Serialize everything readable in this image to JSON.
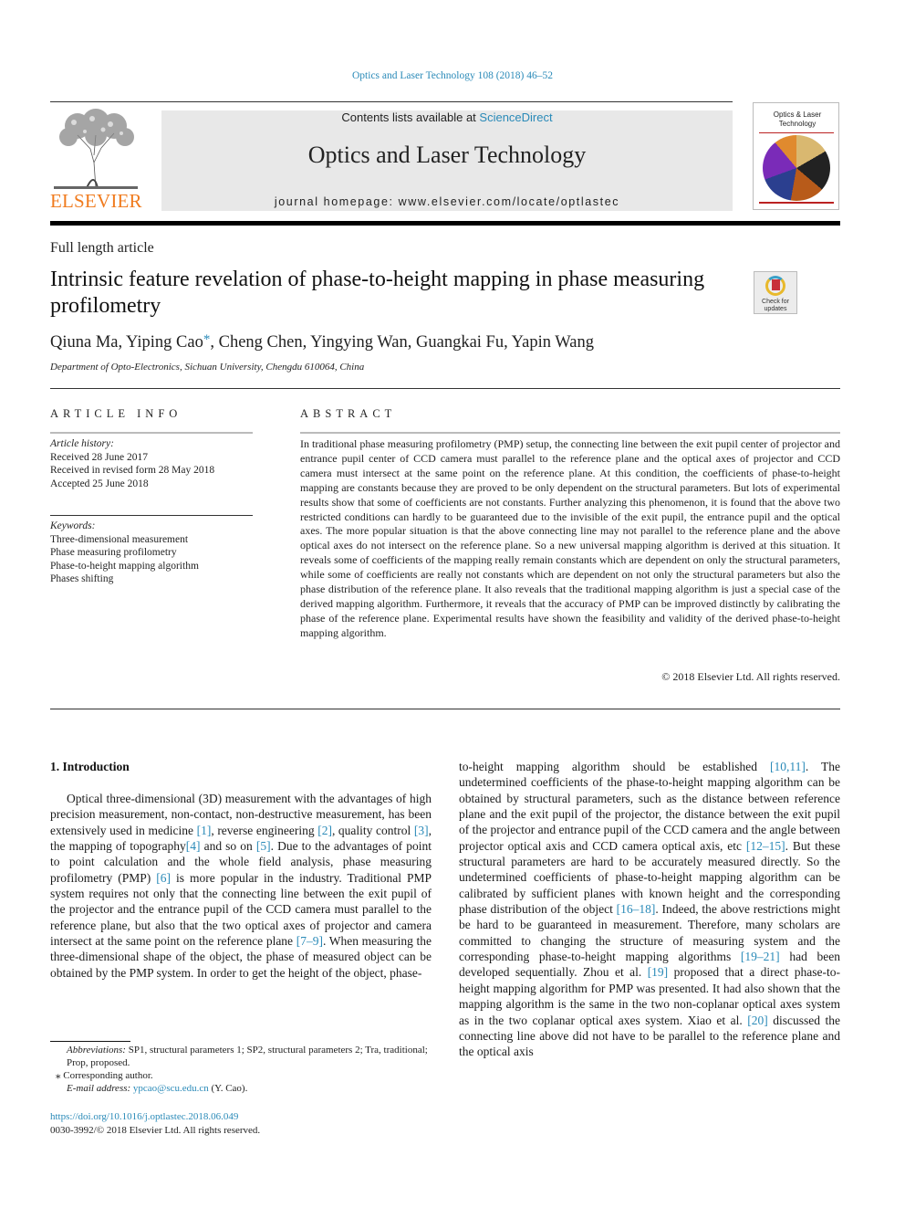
{
  "citation": "Optics and Laser Technology 108 (2018) 46–52",
  "header": {
    "publisher_logo_text": "ELSEVIER",
    "contents_prefix": "Contents lists available at ",
    "contents_link": "ScienceDirect",
    "journal_title": "Optics and Laser Technology",
    "homepage": "journal homepage: www.elsevier.com/locate/optlastec",
    "cover_title": "Optics & Laser Technology"
  },
  "article": {
    "type": "Full length article",
    "title": "Intrinsic feature revelation of phase-to-height mapping in phase measuring profilometry",
    "check_updates": "Check for updates",
    "authors_before": "Qiuna Ma, Yiping Cao",
    "author_star": "*",
    "authors_after": ", Cheng Chen, Yingying Wan, Guangkai Fu, Yapin Wang",
    "affiliation": "Department of Opto-Electronics, Sichuan University, Chengdu 610064, China"
  },
  "article_info": {
    "heading": "ARTICLE INFO",
    "history_label": "Article history:",
    "history": [
      "Received 28 June 2017",
      "Received in revised form 28 May 2018",
      "Accepted 25 June 2018"
    ],
    "keywords_label": "Keywords:",
    "keywords": [
      "Three-dimensional measurement",
      "Phase measuring profilometry",
      "Phase-to-height mapping algorithm",
      "Phases shifting"
    ]
  },
  "abstract": {
    "heading": "ABSTRACT",
    "text": "In traditional phase measuring profilometry (PMP) setup, the connecting line between the exit pupil center of projector and entrance pupil center of CCD camera must parallel to the reference plane and the optical axes of projector and CCD camera must intersect at the same point on the reference plane. At this condition, the coefficients of phase-to-height mapping are constants because they are proved to be only dependent on the structural parameters. But lots of experimental results show that some of coefficients are not constants. Further analyzing this phenomenon, it is found that the above two restricted conditions can hardly to be guaranteed due to the invisible of the exit pupil, the entrance pupil and the optical axes. The more popular situation is that the above connecting line may not parallel to the reference plane and the above optical axes do not intersect on the reference plane. So a new universal mapping algorithm is derived at this situation. It reveals some of coefficients of the mapping really remain constants which are dependent on only the structural parameters, while some of coefficients are really not constants which are dependent on not only the structural parameters but also the phase distribution of the reference plane. It also reveals that the traditional mapping algorithm is just a special case of the derived mapping algorithm. Furthermore, it reveals that the accuracy of PMP can be improved distinctly by calibrating the phase of the reference plane. Experimental results have shown the feasibility and validity of the derived phase-to-height mapping algorithm.",
    "copyright": "© 2018 Elsevier Ltd. All rights reserved."
  },
  "introduction": {
    "heading": "1. Introduction",
    "col1": [
      {
        "t": "Optical three-dimensional (3D) measurement with the advantages of high precision measurement, non-contact, non-destructive measurement, has been extensively used in medicine "
      },
      {
        "ref": "[1]"
      },
      {
        "t": ", reverse engineering "
      },
      {
        "ref": "[2]"
      },
      {
        "t": ", quality control "
      },
      {
        "ref": "[3]"
      },
      {
        "t": ", the mapping of topography"
      },
      {
        "ref": "[4]"
      },
      {
        "t": " and so on "
      },
      {
        "ref": "[5]"
      },
      {
        "t": ". Due to the advantages of point to point calculation and the whole field analysis, phase measuring profilometry (PMP) "
      },
      {
        "ref": "[6]"
      },
      {
        "t": " is more popular in the industry. Traditional PMP system requires not only that the connecting line between the exit pupil of the projector and the entrance pupil of the CCD camera must parallel to the reference plane, but also that the two optical axes of projector and camera intersect at the same point on the reference plane "
      },
      {
        "ref": "[7–9]"
      },
      {
        "t": ". When measuring the three-dimensional shape of the object, the phase of measured object can be obtained by the PMP system. In order to get the height of the object, phase-"
      }
    ],
    "col2": [
      {
        "t": "to-height mapping algorithm should be established "
      },
      {
        "ref": "[10,11]"
      },
      {
        "t": ". The undetermined coefficients of the phase-to-height mapping algorithm can be obtained by structural parameters, such as the distance between reference plane and the exit pupil of the projector, the distance between the exit pupil of the projector and entrance pupil of the CCD camera and the angle between projector optical axis and CCD camera optical axis, etc "
      },
      {
        "ref": "[12–15]"
      },
      {
        "t": ". But these structural parameters are hard to be accurately measured directly. So the undetermined coefficients of phase-to-height mapping algorithm can be calibrated by sufficient planes with known height and the corresponding phase distribution of the object "
      },
      {
        "ref": "[16–18]"
      },
      {
        "t": ". Indeed, the above restrictions might be hard to be guaranteed in measurement. Therefore, many scholars are committed to changing the structure of measuring system and the corresponding phase-to-height mapping algorithms "
      },
      {
        "ref": "[19–21]"
      },
      {
        "t": " had been developed sequentially. Zhou et al. "
      },
      {
        "ref": "[19]"
      },
      {
        "t": " proposed that a direct phase-to-height mapping algorithm for PMP was presented. It had also shown that the mapping algorithm is the same in the two non-coplanar optical axes system as in the two coplanar optical axes system. Xiao et al. "
      },
      {
        "ref": "[20]"
      },
      {
        "t": " discussed the connecting line above did not have to be parallel to the reference plane and the optical axis"
      }
    ]
  },
  "footnotes": {
    "abbrev_label": "Abbreviations:",
    "abbrev_text": " SP1, structural parameters 1; SP2, structural parameters 2; Tra, traditional; Prop, proposed.",
    "corresponding": "⁎ Corresponding author.",
    "email_label": "E-mail address: ",
    "email": "ypcao@scu.edu.cn",
    "email_suffix": " (Y. Cao).",
    "doi": "https://doi.org/10.1016/j.optlastec.2018.06.049",
    "issn": "0030-3992/© 2018 Elsevier Ltd. All rights reserved."
  },
  "colors": {
    "link": "#2a8ab8",
    "elsevier_orange": "#f07b1e",
    "header_gray": "#e8e8e8"
  }
}
